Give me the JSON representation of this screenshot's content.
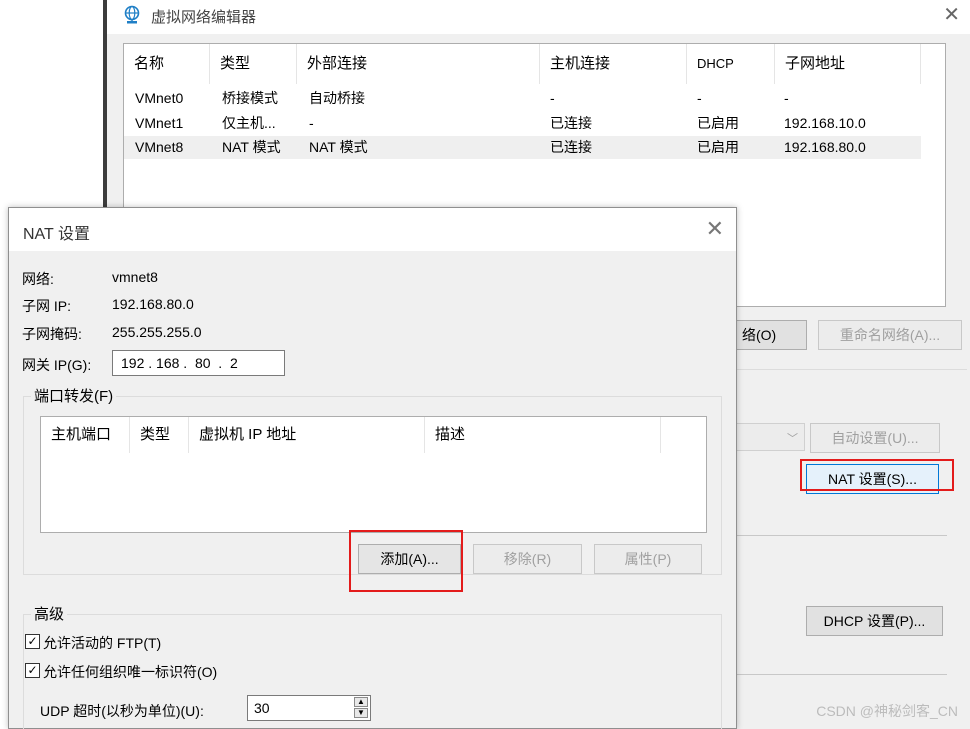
{
  "editor": {
    "title": "虚拟网络编辑器",
    "close_glyph": "✕",
    "columns": [
      "名称",
      "类型",
      "外部连接",
      "主机连接",
      "DHCP",
      "子网地址"
    ],
    "rows": [
      [
        "VMnet0",
        "桥接模式",
        "自动桥接",
        "-",
        "-",
        "-"
      ],
      [
        "VMnet1",
        "仅主机...",
        "-",
        "已连接",
        "已启用",
        "192.168.10.0"
      ],
      [
        "VMnet8",
        "NAT 模式",
        "NAT 模式",
        "已连接",
        "已启用",
        "192.168.80.0"
      ]
    ],
    "remove_network_label": "络(O)",
    "rename_network_label": "重命名网络(A)...",
    "auto_settings_label": "自动设置(U)...",
    "nat_settings_label": "NAT 设置(S)...",
    "dhcp_settings_label": "DHCP 设置(P)..."
  },
  "nat": {
    "title": "NAT 设置",
    "close_glyph": "✕",
    "network_label": "网络:",
    "network_value": "vmnet8",
    "subnet_ip_label": "子网 IP:",
    "subnet_ip_value": "192.168.80.0",
    "subnet_mask_label": "子网掩码:",
    "subnet_mask_value": "255.255.255.0",
    "gateway_label": "网关 IP(G):",
    "gateway_value": "192 . 168 .  80  .  2",
    "port_forwarding_title": "端口转发(F)",
    "pf_columns": [
      "主机端口",
      "类型",
      "虚拟机 IP 地址",
      "描述"
    ],
    "add_label": "添加(A)...",
    "remove_label": "移除(R)",
    "properties_label": "属性(P)",
    "advanced_title": "高级",
    "allow_ftp_label": "允许活动的 FTP(T)",
    "allow_ftp_checked": true,
    "allow_uuid_label": "允许任何组织唯一标识符(O)",
    "allow_uuid_checked": true,
    "udp_label": "UDP 超时(以秒为单位)(U):",
    "udp_value": "30",
    "check_glyph": "✓"
  },
  "watermark": "CSDN @神秘剑客_CN",
  "colors": {
    "highlight_red": "#e31b1b",
    "title_icon_blue": "#1f7fc6"
  }
}
